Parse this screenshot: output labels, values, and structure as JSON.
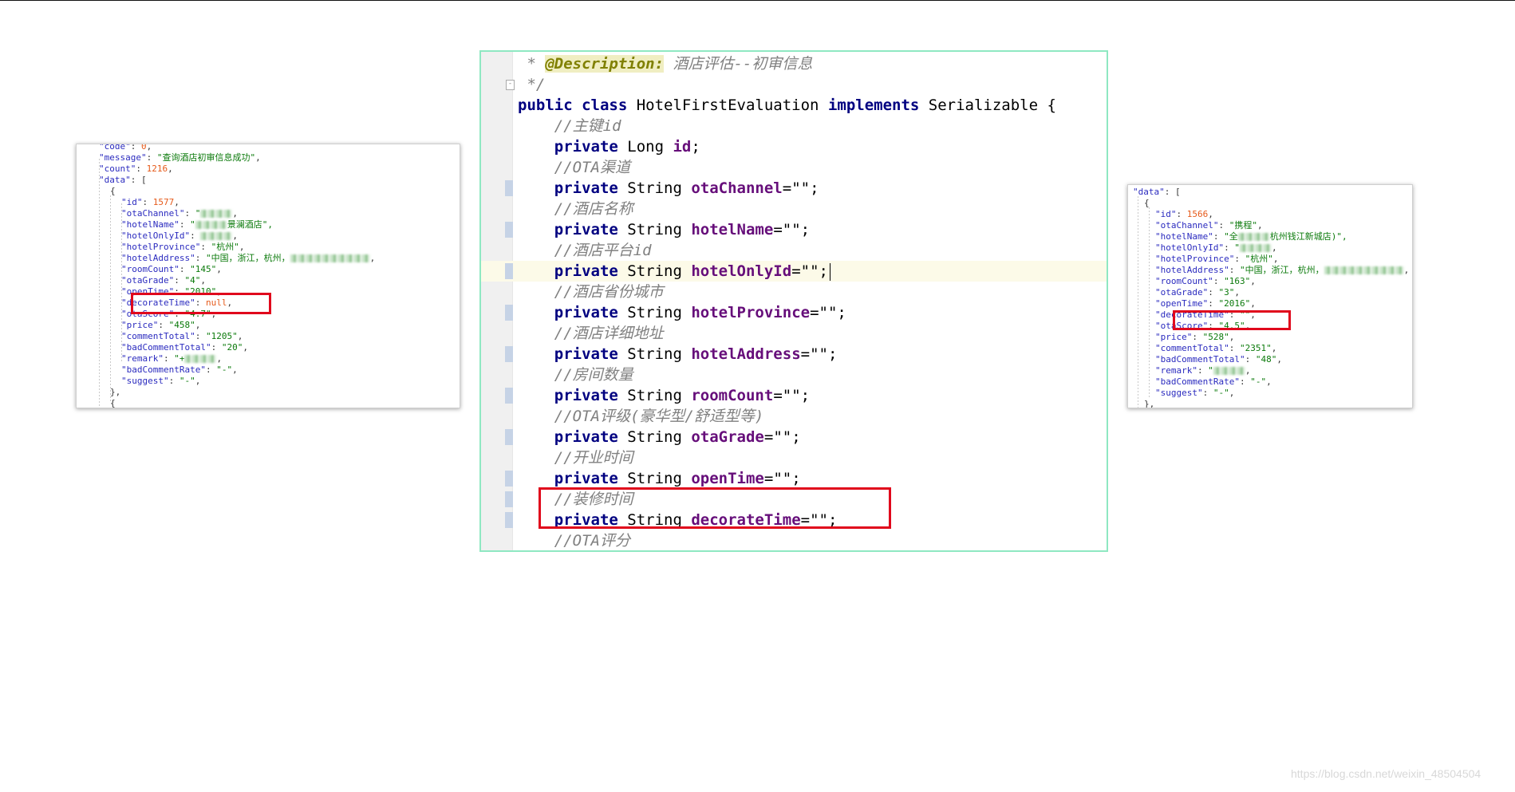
{
  "left_json": {
    "lines": [
      {
        "key": "\"code\"",
        "value": "0",
        "type": "num",
        "indent": 1
      },
      {
        "key": "\"message\"",
        "value": "\"查询酒店初审信息成功\"",
        "type": "str",
        "indent": 1
      },
      {
        "key": "\"count\"",
        "value": "1216",
        "type": "num",
        "indent": 1
      },
      {
        "key": "\"data\"",
        "value": "[",
        "type": "punc",
        "indent": 1
      },
      {
        "key": "",
        "value": "{",
        "type": "punc",
        "indent": 2
      },
      {
        "key": "\"id\"",
        "value": "1577",
        "type": "num",
        "indent": 3
      },
      {
        "key": "\"otaChannel\"",
        "value": "\"",
        "type": "str",
        "indent": 3,
        "blurred": true
      },
      {
        "key": "\"hotelName\"",
        "value": "\"",
        "type": "str",
        "indent": 3,
        "blurred": true,
        "suffix": "景澜酒店\","
      },
      {
        "key": "\"hotelOnlyId\"",
        "value": "",
        "type": "str",
        "indent": 3,
        "blurred": true
      },
      {
        "key": "\"hotelProvince\"",
        "value": "\"杭州\"",
        "type": "str",
        "indent": 3
      },
      {
        "key": "\"hotelAddress\"",
        "value": "\"中国，浙江，杭州，",
        "type": "str",
        "indent": 3,
        "blurred": true
      },
      {
        "key": "\"roomCount\"",
        "value": "\"145\"",
        "type": "str",
        "indent": 3
      },
      {
        "key": "\"otaGrade\"",
        "value": "\"4\"",
        "type": "str",
        "indent": 3
      },
      {
        "key": "\"openTime\"",
        "value": "\"2010\"",
        "type": "str",
        "indent": 3
      },
      {
        "key": "\"decorateTime\"",
        "value": "null",
        "type": "num",
        "indent": 3
      },
      {
        "key": "\"otaScore\"",
        "value": "\"4.7\"",
        "type": "str",
        "indent": 3
      },
      {
        "key": "\"price\"",
        "value": "\"458\"",
        "type": "str",
        "indent": 3
      },
      {
        "key": "\"commentTotal\"",
        "value": "\"1205\"",
        "type": "str",
        "indent": 3
      },
      {
        "key": "\"badCommentTotal\"",
        "value": "\"20\"",
        "type": "str",
        "indent": 3
      },
      {
        "key": "\"remark\"",
        "value": "\"+",
        "type": "str",
        "indent": 3,
        "blurred": true
      },
      {
        "key": "\"badCommentRate\"",
        "value": "\"-\"",
        "type": "str",
        "indent": 3
      },
      {
        "key": "\"suggest\"",
        "value": "\"-\"",
        "type": "str",
        "indent": 3
      },
      {
        "key": "",
        "value": "},",
        "type": "punc",
        "indent": 2
      },
      {
        "key": "",
        "value": "{",
        "type": "punc",
        "indent": 2
      }
    ]
  },
  "right_json": {
    "lines": [
      {
        "key": "\"data\"",
        "value": "[",
        "type": "punc",
        "indent": 0
      },
      {
        "key": "",
        "value": "{",
        "type": "punc",
        "indent": 1
      },
      {
        "key": "\"id\"",
        "value": "1566",
        "type": "num",
        "indent": 2
      },
      {
        "key": "\"otaChannel\"",
        "value": "\"携程\"",
        "type": "str",
        "indent": 2
      },
      {
        "key": "\"hotelName\"",
        "value": "\"全",
        "type": "str",
        "indent": 2,
        "blurred": true,
        "suffix": "杭州钱江新城店)\","
      },
      {
        "key": "\"hotelOnlyId\"",
        "value": "\"",
        "type": "str",
        "indent": 2,
        "blurred": true
      },
      {
        "key": "\"hotelProvince\"",
        "value": "\"杭州\"",
        "type": "str",
        "indent": 2
      },
      {
        "key": "\"hotelAddress\"",
        "value": "\"中国，浙江，杭州，",
        "type": "str",
        "indent": 2,
        "blurred": true
      },
      {
        "key": "\"roomCount\"",
        "value": "\"163\"",
        "type": "str",
        "indent": 2
      },
      {
        "key": "\"otaGrade\"",
        "value": "\"3\"",
        "type": "str",
        "indent": 2
      },
      {
        "key": "\"openTime\"",
        "value": "\"2016\"",
        "type": "str",
        "indent": 2
      },
      {
        "key": "\"decorateTime\"",
        "value": "\"\"",
        "type": "str",
        "indent": 2
      },
      {
        "key": "\"otaScore\"",
        "value": "\"4.5\"",
        "type": "str",
        "indent": 2
      },
      {
        "key": "\"price\"",
        "value": "\"528\"",
        "type": "str",
        "indent": 2
      },
      {
        "key": "\"commentTotal\"",
        "value": "\"2351\"",
        "type": "str",
        "indent": 2
      },
      {
        "key": "\"badCommentTotal\"",
        "value": "\"48\"",
        "type": "str",
        "indent": 2
      },
      {
        "key": "\"remark\"",
        "value": "\"",
        "type": "str",
        "indent": 2,
        "blurred": true
      },
      {
        "key": "\"badCommentRate\"",
        "value": "\"-\"",
        "type": "str",
        "indent": 2
      },
      {
        "key": "\"suggest\"",
        "value": "\"-\"",
        "type": "str",
        "indent": 2
      },
      {
        "key": "",
        "value": "},",
        "type": "punc",
        "indent": 1
      }
    ]
  },
  "code": {
    "lines": [
      [
        {
          "t": "cmt",
          "v": " * "
        },
        {
          "t": "ann",
          "v": "@Description:"
        },
        {
          "t": "cmt",
          "v": " 酒店评估--初审信息"
        }
      ],
      [
        {
          "t": "cmt",
          "v": " */"
        }
      ],
      [
        {
          "t": "kw",
          "v": "public class "
        },
        {
          "t": "txt",
          "v": "HotelFirstEvaluation "
        },
        {
          "t": "kw",
          "v": "implements "
        },
        {
          "t": "txt",
          "v": "Serializable {"
        }
      ],
      [
        {
          "t": "txt",
          "v": "    "
        },
        {
          "t": "cmt",
          "v": "//主键id"
        }
      ],
      [
        {
          "t": "txt",
          "v": "    "
        },
        {
          "t": "kw",
          "v": "private "
        },
        {
          "t": "txt",
          "v": "Long "
        },
        {
          "t": "fld",
          "v": "id"
        },
        {
          "t": "txt",
          "v": ";"
        }
      ],
      [
        {
          "t": "txt",
          "v": "    "
        },
        {
          "t": "cmt",
          "v": "//OTA渠道"
        }
      ],
      [
        {
          "t": "txt",
          "v": "    "
        },
        {
          "t": "kw",
          "v": "private "
        },
        {
          "t": "txt",
          "v": "String "
        },
        {
          "t": "fld",
          "v": "otaChannel"
        },
        {
          "t": "txt",
          "v": "=\"\";"
        }
      ],
      [
        {
          "t": "txt",
          "v": "    "
        },
        {
          "t": "cmt",
          "v": "//酒店名称"
        }
      ],
      [
        {
          "t": "txt",
          "v": "    "
        },
        {
          "t": "kw",
          "v": "private "
        },
        {
          "t": "txt",
          "v": "String "
        },
        {
          "t": "fld",
          "v": "hotelName"
        },
        {
          "t": "txt",
          "v": "=\"\";"
        }
      ],
      [
        {
          "t": "txt",
          "v": "    "
        },
        {
          "t": "cmt",
          "v": "//酒店平台id"
        }
      ],
      [
        {
          "t": "txt",
          "v": "    "
        },
        {
          "t": "kw",
          "v": "private "
        },
        {
          "t": "txt",
          "v": "String "
        },
        {
          "t": "fld",
          "v": "hotelOnlyId"
        },
        {
          "t": "txt",
          "v": "=\"\";"
        }
      ],
      [
        {
          "t": "txt",
          "v": "    "
        },
        {
          "t": "cmt",
          "v": "//酒店省份城市"
        }
      ],
      [
        {
          "t": "txt",
          "v": "    "
        },
        {
          "t": "kw",
          "v": "private "
        },
        {
          "t": "txt",
          "v": "String "
        },
        {
          "t": "fld",
          "v": "hotelProvince"
        },
        {
          "t": "txt",
          "v": "=\"\";"
        }
      ],
      [
        {
          "t": "txt",
          "v": "    "
        },
        {
          "t": "cmt",
          "v": "//酒店详细地址"
        }
      ],
      [
        {
          "t": "txt",
          "v": "    "
        },
        {
          "t": "kw",
          "v": "private "
        },
        {
          "t": "txt",
          "v": "String "
        },
        {
          "t": "fld",
          "v": "hotelAddress"
        },
        {
          "t": "txt",
          "v": "=\"\";"
        }
      ],
      [
        {
          "t": "txt",
          "v": "    "
        },
        {
          "t": "cmt",
          "v": "//房间数量"
        }
      ],
      [
        {
          "t": "txt",
          "v": "    "
        },
        {
          "t": "kw",
          "v": "private "
        },
        {
          "t": "txt",
          "v": "String "
        },
        {
          "t": "fld",
          "v": "roomCount"
        },
        {
          "t": "txt",
          "v": "=\"\";"
        }
      ],
      [
        {
          "t": "txt",
          "v": "    "
        },
        {
          "t": "cmt",
          "v": "//OTA评级(豪华型/舒适型等)"
        }
      ],
      [
        {
          "t": "txt",
          "v": "    "
        },
        {
          "t": "kw",
          "v": "private "
        },
        {
          "t": "txt",
          "v": "String "
        },
        {
          "t": "fld",
          "v": "otaGrade"
        },
        {
          "t": "txt",
          "v": "=\"\";"
        }
      ],
      [
        {
          "t": "txt",
          "v": "    "
        },
        {
          "t": "cmt",
          "v": "//开业时间"
        }
      ],
      [
        {
          "t": "txt",
          "v": "    "
        },
        {
          "t": "kw",
          "v": "private "
        },
        {
          "t": "txt",
          "v": "String "
        },
        {
          "t": "fld",
          "v": "openTime"
        },
        {
          "t": "txt",
          "v": "=\"\";"
        }
      ],
      [
        {
          "t": "txt",
          "v": "    "
        },
        {
          "t": "cmt",
          "v": "//装修时间"
        }
      ],
      [
        {
          "t": "txt",
          "v": "    "
        },
        {
          "t": "kw",
          "v": "private "
        },
        {
          "t": "txt",
          "v": "String "
        },
        {
          "t": "fld",
          "v": "decorateTime"
        },
        {
          "t": "txt",
          "v": "=\"\";"
        }
      ],
      [
        {
          "t": "txt",
          "v": "    "
        },
        {
          "t": "cmt",
          "v": "//OTA评分"
        }
      ]
    ]
  },
  "watermark": "https://blog.csdn.net/weixin_48504504"
}
